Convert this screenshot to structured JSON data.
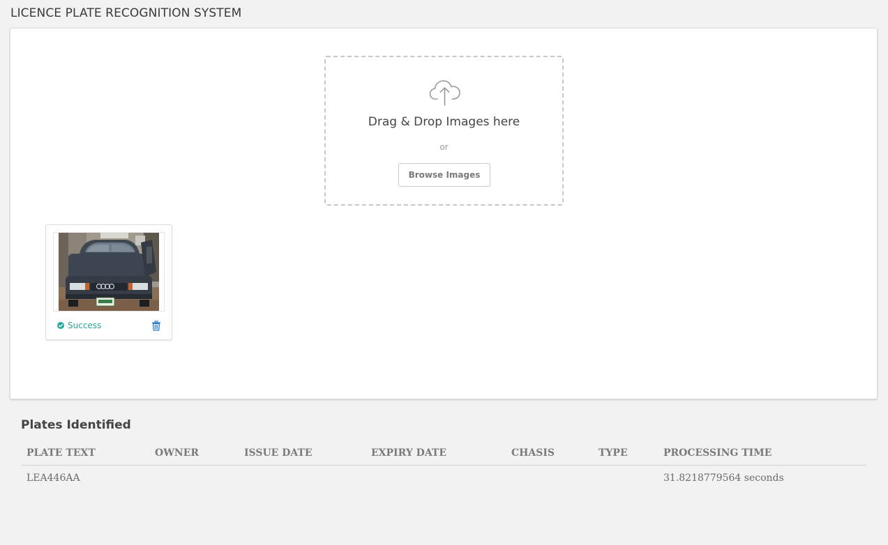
{
  "app": {
    "title": "LICENCE PLATE RECOGNITION SYSTEM"
  },
  "upload": {
    "dropzone_title": "Drag & Drop Images here",
    "or_text": "or",
    "browse_label": "Browse Images",
    "icon": "cloud-upload-icon"
  },
  "uploaded_files": [
    {
      "status": "Success",
      "status_icon": "check-circle-icon",
      "delete_icon": "trash-icon"
    }
  ],
  "results": {
    "title": "Plates Identified",
    "columns": [
      "PLATE TEXT",
      "OWNER",
      "ISSUE DATE",
      "EXPIRY DATE",
      "CHASIS",
      "TYPE",
      "PROCESSING TIME"
    ],
    "rows": [
      {
        "plate_text": "LEA446AA",
        "owner": "",
        "issue_date": "",
        "expiry_date": "",
        "chasis": "",
        "type": "",
        "processing_time": "31.8218779564 seconds"
      }
    ]
  },
  "colors": {
    "success": "#27a79a",
    "page_bg": "#f2f2f2",
    "card_bg": "#ffffff",
    "trash": "#2a7fc9"
  }
}
